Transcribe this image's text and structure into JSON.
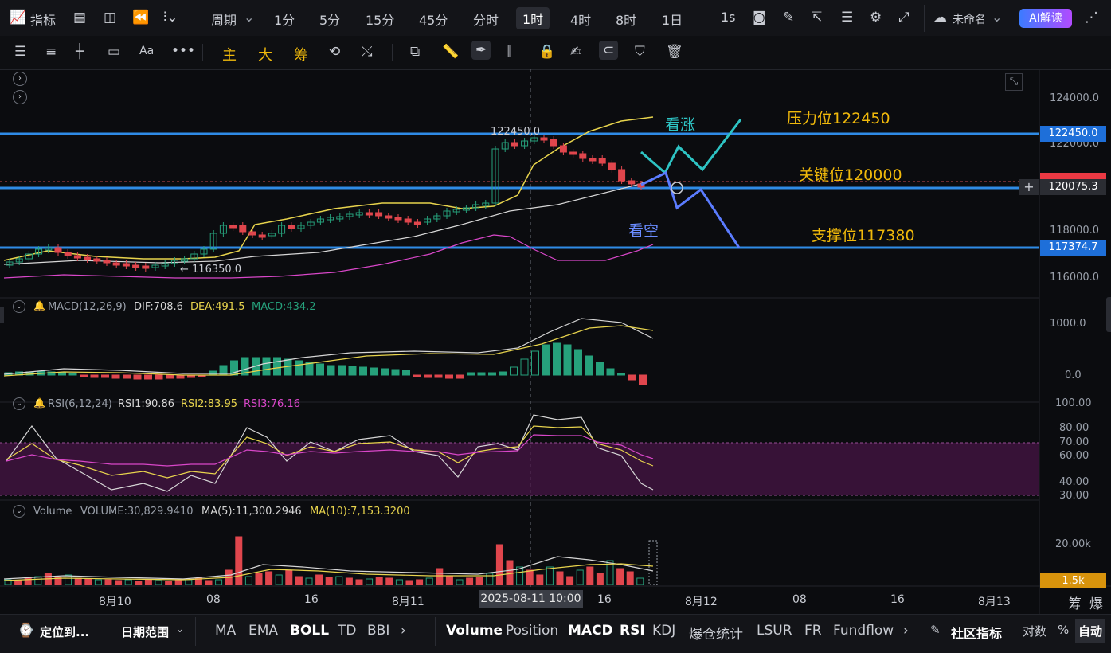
{
  "topbar": {
    "indicator_label": "指标",
    "period_label": "周期",
    "timeframes": [
      "1分",
      "5分",
      "15分",
      "45分",
      "分时",
      "1时",
      "4时",
      "8时",
      "1日"
    ],
    "active_timeframe": "1时",
    "speed": "1s",
    "workspace_name": "未命名",
    "ai_button": "AI解读"
  },
  "toolbar2": {
    "chars": [
      "主",
      "大",
      "筹"
    ]
  },
  "chart": {
    "price_axis": [
      "124000.0",
      "122000.0",
      "118000.0",
      "116000.0"
    ],
    "tags": [
      {
        "label": "122450.0",
        "color": "#1e6fd9"
      },
      {
        "label": "120075.3",
        "color": "#2b2d33"
      },
      {
        "label": "117374.7",
        "color": "#1e6fd9"
      }
    ],
    "high_marker": "122450.0",
    "low_marker": "← 116350.0",
    "annotations": {
      "bullish": "看涨",
      "resistance": "压力位122450",
      "key_level": "关键位120000",
      "bearish": "看空",
      "support": "支撑位117380"
    }
  },
  "macd": {
    "name": "MACD(12,26,9)",
    "dif": "DIF:708.6",
    "dea": "DEA:491.5",
    "macd": "MACD:434.2",
    "axis": [
      "1000.0",
      "0.0"
    ]
  },
  "rsi": {
    "name": "RSI(6,12,24)",
    "rsi1": "RSI1:90.86",
    "rsi2": "RSI2:83.95",
    "rsi3": "RSI3:76.16",
    "axis": [
      "100.00",
      "80.00",
      "70.00",
      "60.00",
      "40.00",
      "30.00"
    ]
  },
  "volume": {
    "name": "Volume",
    "vol": "VOLUME:30,829.9410",
    "ma5": "MA(5):11,300.2946",
    "ma10": "MA(10):7,153.3200",
    "axis": "20.00k",
    "tag": "1.5k"
  },
  "time_axis": {
    "labels": [
      "8月10",
      "08",
      "16",
      "8月11",
      "16",
      "8月12",
      "08",
      "16",
      "8月13"
    ],
    "crosshair": "2025-08-11 10:00",
    "right_chars": [
      "筹",
      "爆"
    ]
  },
  "bottombar": {
    "locate": "定位到...",
    "range": "日期范围",
    "main_inds": [
      "MA",
      "EMA",
      "BOLL",
      "TD",
      "BBI"
    ],
    "sub_inds": [
      "Volume",
      "Position",
      "MACD",
      "RSI",
      "KDJ",
      "爆仓统计",
      "LSUR",
      "FR",
      "Fundflow"
    ],
    "community": "社区指标",
    "log": "对数",
    "pct": "%",
    "auto": "自动"
  },
  "colors": {
    "accent_blue": "#1e6fd9",
    "up": "#26a17b",
    "down": "#e0464d",
    "yellow": "#f0b90b",
    "ann_cyan": "#2ec4c4",
    "ann_blue": "#5b7cff"
  }
}
